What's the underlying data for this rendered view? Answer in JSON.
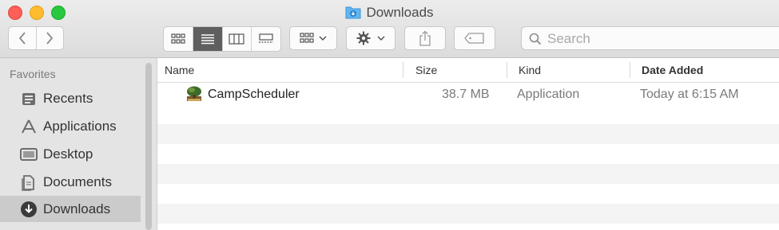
{
  "window": {
    "title": "Downloads"
  },
  "toolbar": {
    "search_placeholder": "Search"
  },
  "sidebar": {
    "heading": "Favorites",
    "items": [
      {
        "label": "Recents"
      },
      {
        "label": "Applications"
      },
      {
        "label": "Desktop"
      },
      {
        "label": "Documents"
      },
      {
        "label": "Downloads",
        "selected": true
      }
    ]
  },
  "list": {
    "columns": [
      "Name",
      "Size",
      "Kind",
      "Date Added"
    ],
    "rows": [
      {
        "name": "CampScheduler",
        "size": "38.7 MB",
        "kind": "Application",
        "date_added": "Today at 6:15 AM"
      }
    ]
  },
  "colors": {
    "accent": "#5f5f5f",
    "close": "#fe5f57",
    "minimize": "#febc2e",
    "maximize": "#28c840"
  }
}
